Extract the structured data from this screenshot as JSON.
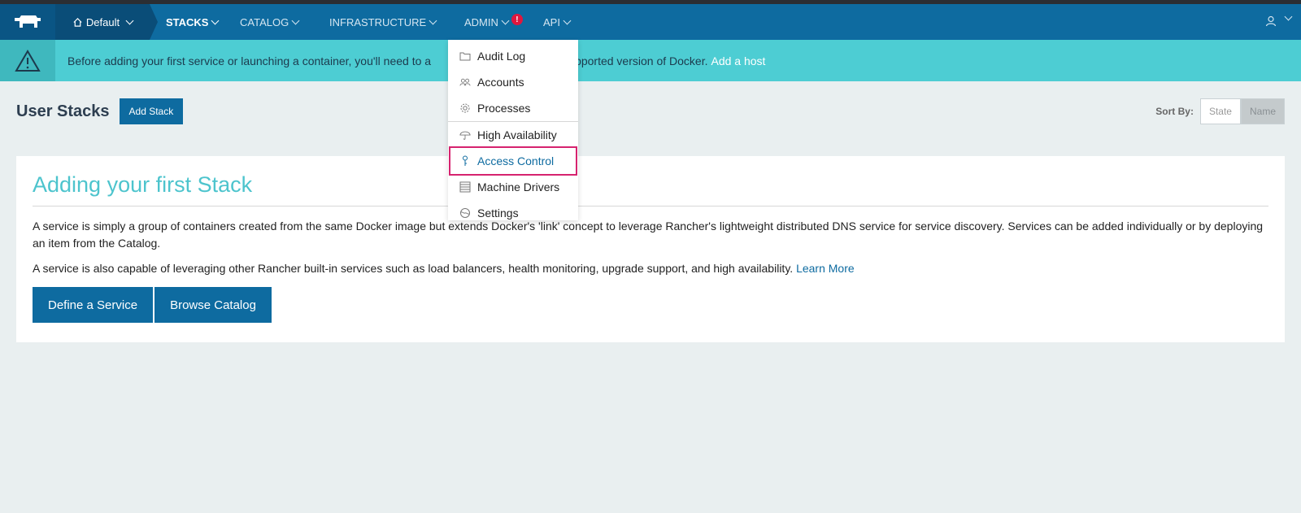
{
  "nav": {
    "environment": "Default",
    "items": [
      {
        "label": "STACKS",
        "active": true
      },
      {
        "label": "CATALOG",
        "active": false
      },
      {
        "label": "INFRASTRUCTURE",
        "active": false
      },
      {
        "label": "ADMIN",
        "active": false,
        "badge": "!"
      },
      {
        "label": "API",
        "active": false
      }
    ]
  },
  "banner": {
    "text_before": "Before adding your first service or launching a container, you'll need to a",
    "text_after": "pported version of Docker.",
    "link": "Add a host"
  },
  "page": {
    "title": "User Stacks",
    "add_button": "Add Stack",
    "sort_label": "Sort By:",
    "sort_options": [
      "State",
      "Name"
    ],
    "sort_selected": "Name"
  },
  "card": {
    "title": "Adding your first Stack",
    "paragraph1": "A service is simply a group of containers created from the same Docker image but extends Docker's 'link' concept to leverage Rancher's lightweight distributed DNS service for service discovery. Services can be added individually or by deploying an item from the Catalog.",
    "paragraph2": "A service is also capable of leveraging other Rancher built-in services such as load balancers, health monitoring, upgrade support, and high availability.",
    "learn_more": "Learn More",
    "button_define": "Define a Service",
    "button_browse": "Browse Catalog"
  },
  "admin_menu": {
    "items": [
      {
        "label": "Audit Log",
        "icon": "folder-icon"
      },
      {
        "label": "Accounts",
        "icon": "users-icon"
      },
      {
        "label": "Processes",
        "icon": "gear-icon"
      },
      {
        "label": "High Availability",
        "icon": "umbrella-icon"
      },
      {
        "label": "Access Control",
        "icon": "key-icon"
      },
      {
        "label": "Machine Drivers",
        "icon": "server-icon"
      },
      {
        "label": "Settings",
        "icon": "globe-icon"
      }
    ],
    "highlighted": "Access Control"
  },
  "colors": {
    "navbar": "#0e6ba0",
    "banner": "#4dcdd3",
    "accent_title": "#4dc4cd",
    "highlight_outline": "#d6236f",
    "badge": "#e0173e"
  }
}
